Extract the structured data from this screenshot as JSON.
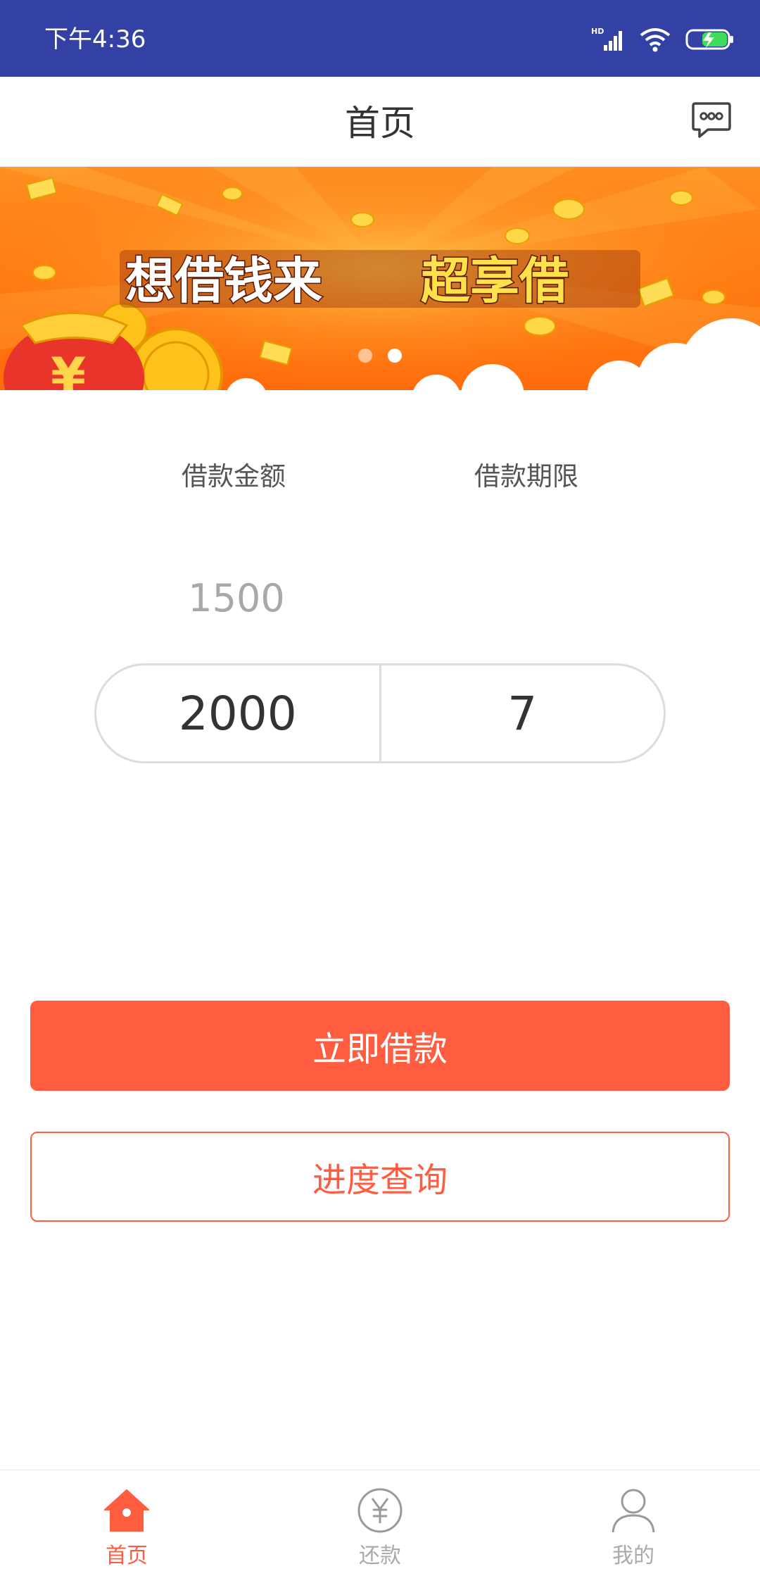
{
  "status_bar": {
    "time": "下午4:36",
    "icons": [
      "hd-signal-icon",
      "wifi-icon",
      "battery-charging-icon"
    ]
  },
  "header": {
    "title": "首页",
    "message_icon": "message-icon"
  },
  "banner": {
    "headline_left": "想借钱来",
    "headline_right": "超享借",
    "dots": 2,
    "active_dot": 2
  },
  "loan_form": {
    "amount_label": "借款金额",
    "term_label": "借款期限",
    "amount_previous": "1500",
    "amount_selected": "2000",
    "term_selected": "7"
  },
  "actions": {
    "apply_label": "立即借款",
    "progress_label": "进度查询"
  },
  "bottom_nav": {
    "items": [
      {
        "label": "首页",
        "icon": "home-icon",
        "active": true
      },
      {
        "label": "还款",
        "icon": "yen-circle-icon",
        "active": false
      },
      {
        "label": "我的",
        "icon": "person-icon",
        "active": false
      }
    ]
  },
  "colors": {
    "status_bar": "#3341a5",
    "accent": "#ff5c40",
    "banner": "#ff7a10"
  }
}
